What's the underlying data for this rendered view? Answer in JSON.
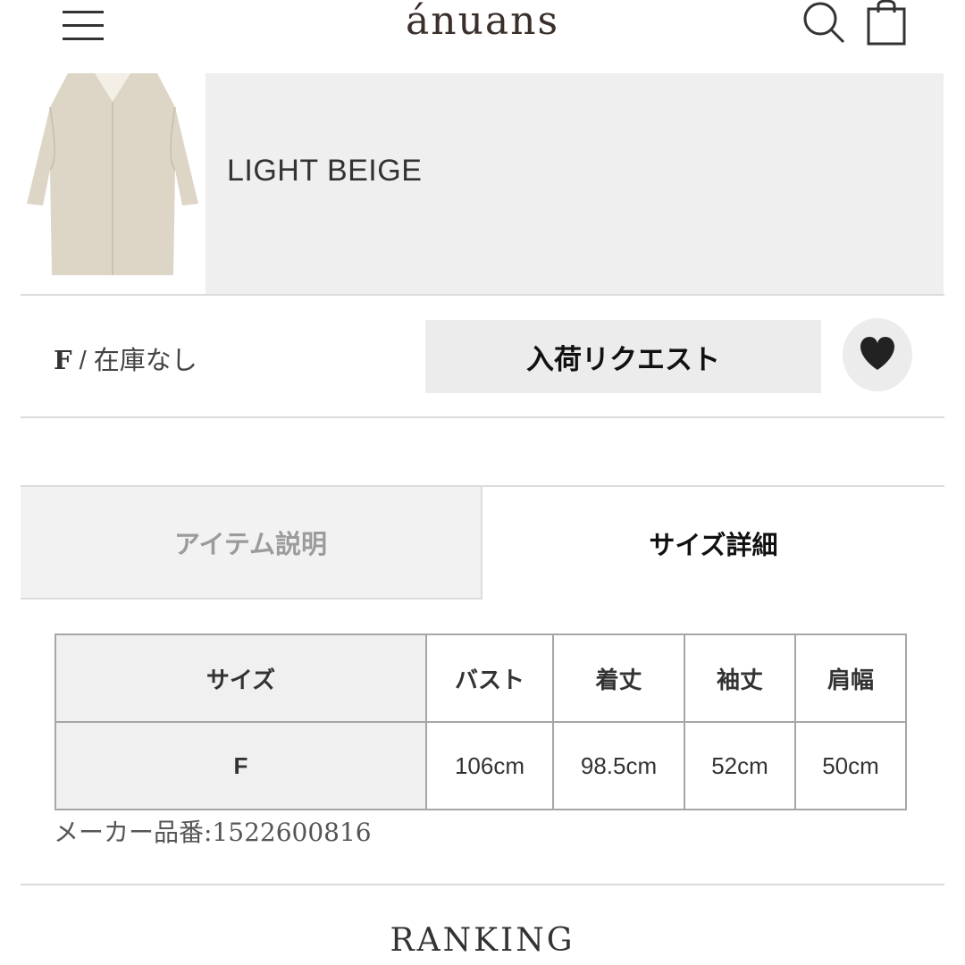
{
  "header": {
    "logo": "ánuans",
    "menu_icon": "hamburger-menu-icon",
    "search_icon": "search-icon",
    "bag_icon": "shopping-bag-icon"
  },
  "product": {
    "color_name": "LIGHT BEIGE",
    "size": "F",
    "stock_status": "/ 在庫なし",
    "request_button": "入荷リクエスト",
    "favorite_icon": "heart-icon"
  },
  "tabs": [
    {
      "label": "アイテム説明",
      "active": false
    },
    {
      "label": "サイズ詳細",
      "active": true
    }
  ],
  "size_table": {
    "headers": [
      "サイズ",
      "バスト",
      "着丈",
      "袖丈",
      "肩幅"
    ],
    "rows": [
      [
        "F",
        "106cm",
        "98.5cm",
        "52cm",
        "50cm"
      ]
    ]
  },
  "maker_number": "メーカー品番:1522600816",
  "ranking_title": "RANKING",
  "colors": {
    "panel_bg": "#efefef",
    "button_bg": "#ececec",
    "coat": "#ddd6c7"
  }
}
